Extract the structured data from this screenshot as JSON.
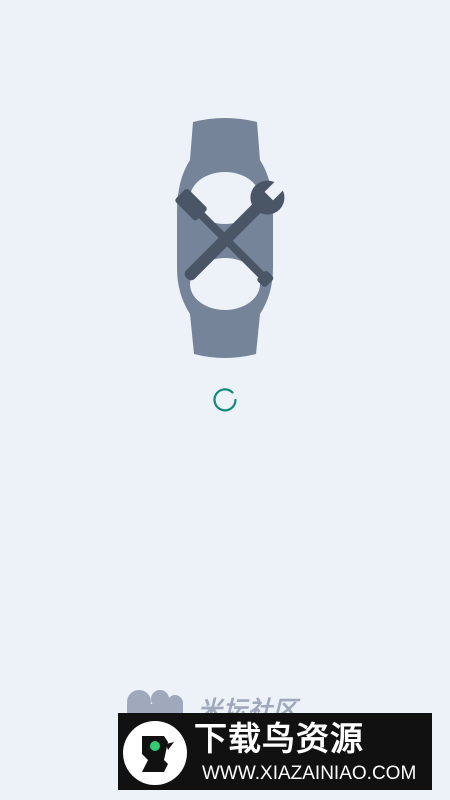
{
  "splash": {
    "illustration_icon": "watch-band-repair-icon",
    "spinner_icon": "loading-spinner-icon",
    "brand": {
      "logo_icon": "miui-community-logo-icon",
      "name": "米坛社区"
    }
  },
  "watermark": {
    "logo_icon": "bird-logo-icon",
    "title": "下载鸟资源",
    "url": "WWW.XIAZAINIAO.COM"
  },
  "colors": {
    "background": "#edf2f9",
    "band": "#76849a",
    "tools": "#4a5565",
    "spinner": "#0f8a7a",
    "brand_text": "#9fa9bb",
    "watermark_bg": "#111111",
    "watermark_accent": "#2ecc71"
  }
}
